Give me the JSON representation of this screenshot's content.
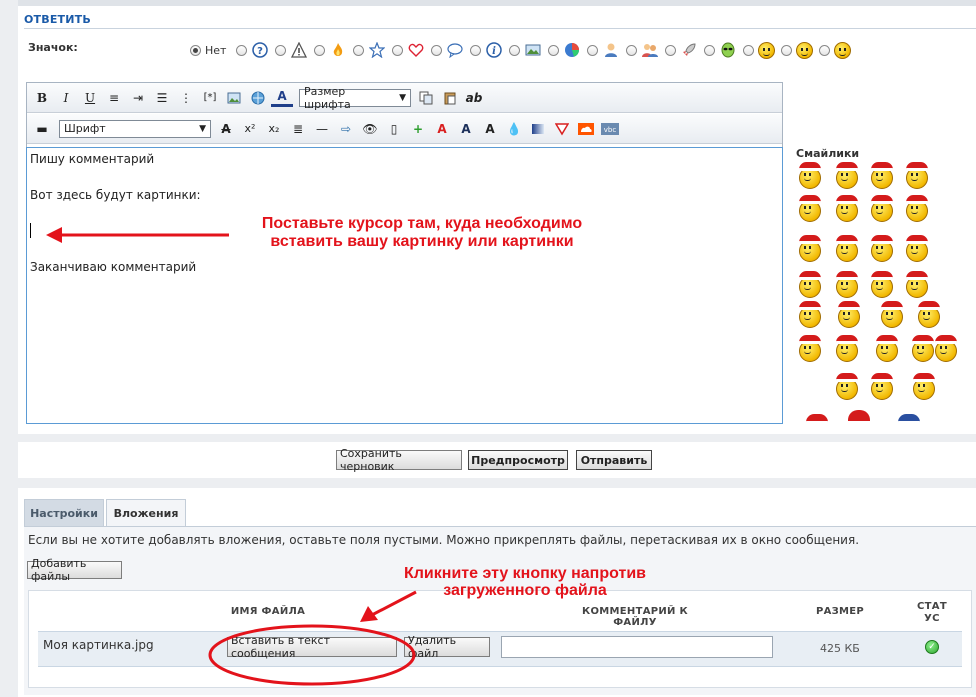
{
  "reply": {
    "title": "ОТВЕТИТЬ"
  },
  "icon_picker": {
    "label": "Значок:",
    "none_label": "Нет",
    "options": [
      "question-icon",
      "warning-icon",
      "fire-icon",
      "star-icon",
      "heart-icon",
      "speech-icon",
      "info-icon",
      "picture-icon",
      "chart-icon",
      "user-icon",
      "users-icon",
      "rocket-icon",
      "alien-icon",
      "smile-icon",
      "sad-icon",
      "wink-icon"
    ]
  },
  "toolbar": {
    "font_size_label": "Размер шрифта",
    "font_label": "Шрифт"
  },
  "editor": {
    "line1": "Пишу комментарий",
    "line2": "Вот здесь будут картинки:",
    "line3": "Заканчиваю комментарий"
  },
  "annotations": {
    "cursor_line1": "Поставьте курсор там, куда необходимо",
    "cursor_line2": "вставить вашу картинку или картинки",
    "button_line1": "Кликните эту кнопку напротив",
    "button_line2": "загруженного файла"
  },
  "smilies": {
    "title": "Смайлики"
  },
  "actions": {
    "save_draft": "Сохранить черновик",
    "preview": "Предпросмотр",
    "send": "Отправить"
  },
  "tabs": {
    "settings": "Настройки",
    "attachments": "Вложения"
  },
  "attachments": {
    "hint": "Если вы не хотите добавлять вложения, оставьте поля пустыми. Можно прикреплять файлы, перетаскивая их в окно сообщения.",
    "add_files": "Добавить файлы",
    "col_name": "ИМЯ ФАЙЛА",
    "col_comment": "КОММЕНТАРИЙ К ФАЙЛУ",
    "col_size": "РАЗМЕР",
    "col_status_1": "СТАТ",
    "col_status_2": "УС",
    "file": {
      "name": "Моя картинка.jpg",
      "insert": "Вставить в текст сообщения",
      "delete": "Удалить файл",
      "size": "425 КБ"
    }
  },
  "colors": {
    "accent": "#1a5aa8",
    "annotation": "#e3131b",
    "editor_border": "#5b9bd5"
  }
}
